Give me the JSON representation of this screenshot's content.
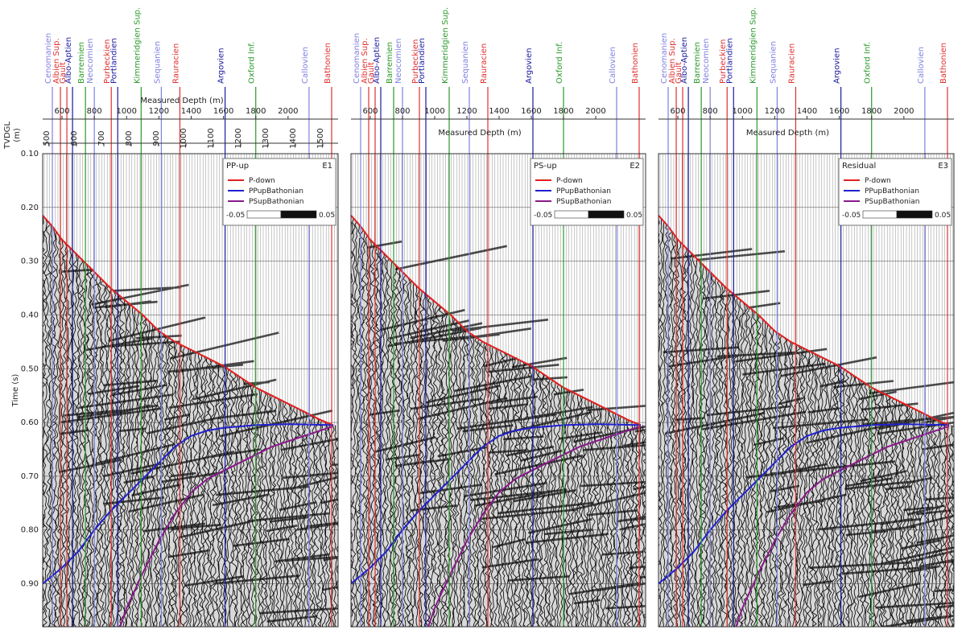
{
  "chart_data": {
    "type": "seismic-section",
    "time_axis": {
      "label": "Time (s)",
      "ticks": [
        "0.10",
        "0.20",
        "0.30",
        "0.40",
        "0.50",
        "0.60",
        "0.70",
        "0.80",
        "0.90"
      ],
      "range": [
        0.1,
        0.98
      ]
    },
    "tvdgl_axis": {
      "label": "TVDGL (m)",
      "ticks": [
        500,
        600,
        700,
        800,
        900,
        1000,
        1100,
        1200,
        1300,
        1400,
        1500
      ]
    },
    "md_axis": {
      "label": "Measured Depth (m)",
      "ticks": [
        600,
        800,
        1000,
        1200,
        1400,
        1600,
        1800,
        2000
      ],
      "range": [
        480,
        2310
      ]
    },
    "horizons": [
      {
        "name": "Cenomanien",
        "md": 540,
        "color": "#8080e0"
      },
      {
        "name": "Albien Sup.",
        "md": 590,
        "color": "#e03030"
      },
      {
        "name": "Gault",
        "md": 630,
        "color": "#e03030"
      },
      {
        "name": "Albo-Aptien",
        "md": 665,
        "color": "#1a1aa0"
      },
      {
        "name": "Barremien",
        "md": 745,
        "color": "#2a9a2a"
      },
      {
        "name": "Neocomien",
        "md": 800,
        "color": "#8080e0"
      },
      {
        "name": "Purbeckien",
        "md": 905,
        "color": "#e03030"
      },
      {
        "name": "Portlandien",
        "md": 945,
        "color": "#1a1aa0"
      },
      {
        "name": "Kimmeridgien Sup.",
        "md": 1090,
        "color": "#2a9a2a"
      },
      {
        "name": "Sequanien",
        "md": 1215,
        "color": "#8080e0"
      },
      {
        "name": "Rauracien",
        "md": 1330,
        "color": "#e03030"
      },
      {
        "name": "Argovien",
        "md": 1610,
        "color": "#1a1aa0"
      },
      {
        "name": "Oxford Inf.",
        "md": 1800,
        "color": "#2a9a2a"
      },
      {
        "name": "Callovien",
        "md": 2130,
        "color": "#8080e0"
      },
      {
        "name": "Bathonien",
        "md": 2270,
        "color": "#e03030"
      }
    ],
    "curves": {
      "p_down": [
        [
          480,
          0.215
        ],
        [
          540,
          0.235
        ],
        [
          600,
          0.26
        ],
        [
          700,
          0.29
        ],
        [
          800,
          0.32
        ],
        [
          900,
          0.35
        ],
        [
          1000,
          0.375
        ],
        [
          1100,
          0.4
        ],
        [
          1200,
          0.43
        ],
        [
          1300,
          0.45
        ],
        [
          1400,
          0.465
        ],
        [
          1500,
          0.48
        ],
        [
          1600,
          0.495
        ],
        [
          1700,
          0.515
        ],
        [
          1800,
          0.535
        ],
        [
          1900,
          0.55
        ],
        [
          2000,
          0.565
        ],
        [
          2100,
          0.58
        ],
        [
          2200,
          0.595
        ],
        [
          2280,
          0.605
        ]
      ],
      "pp_up": [
        [
          480,
          0.9
        ],
        [
          600,
          0.87
        ],
        [
          700,
          0.84
        ],
        [
          800,
          0.8
        ],
        [
          900,
          0.765
        ],
        [
          1000,
          0.735
        ],
        [
          1100,
          0.705
        ],
        [
          1200,
          0.675
        ],
        [
          1300,
          0.645
        ],
        [
          1400,
          0.625
        ],
        [
          1500,
          0.615
        ],
        [
          1600,
          0.61
        ],
        [
          1800,
          0.605
        ],
        [
          2000,
          0.603
        ],
        [
          2280,
          0.605
        ]
      ],
      "ps_up": [
        [
          960,
          0.98
        ],
        [
          1000,
          0.945
        ],
        [
          1100,
          0.88
        ],
        [
          1200,
          0.82
        ],
        [
          1300,
          0.77
        ],
        [
          1400,
          0.73
        ],
        [
          1500,
          0.705
        ],
        [
          1600,
          0.69
        ],
        [
          1700,
          0.675
        ],
        [
          1800,
          0.66
        ],
        [
          1900,
          0.645
        ],
        [
          2000,
          0.635
        ],
        [
          2100,
          0.625
        ],
        [
          2280,
          0.607
        ]
      ]
    },
    "panels": [
      {
        "id": "E1",
        "title": "PP-up"
      },
      {
        "id": "E2",
        "title": "PS-up"
      },
      {
        "id": "E3",
        "title": "Residual"
      }
    ],
    "legend": {
      "entries": [
        {
          "name": "P-down",
          "color": "#e02020"
        },
        {
          "name": "PPupBathonian",
          "color": "#2020d0"
        },
        {
          "name": "PSupBathonian",
          "color": "#8a1a8a"
        }
      ],
      "scale_min": "-0.05",
      "scale_max": "0.05"
    }
  }
}
